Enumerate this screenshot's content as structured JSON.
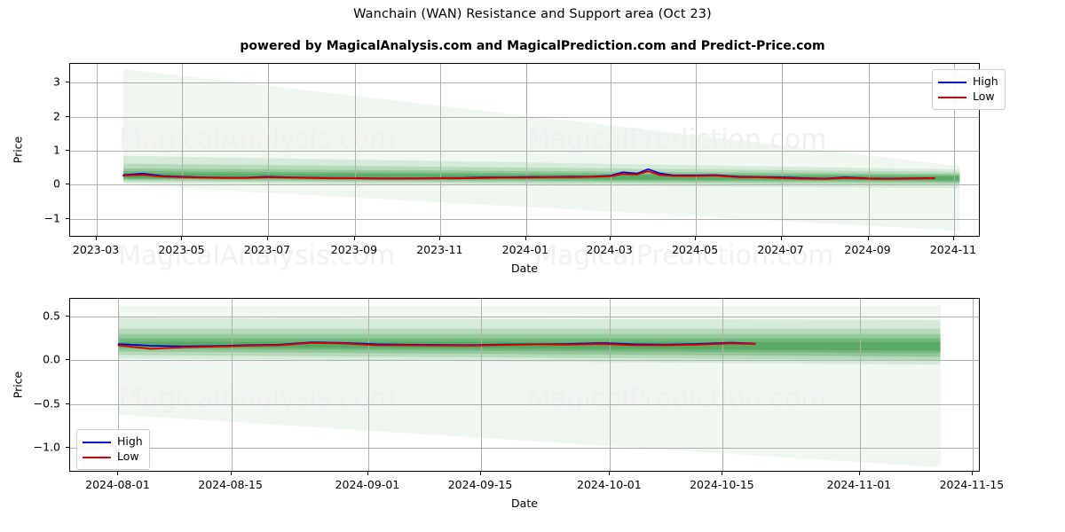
{
  "title": "Wanchain (WAN) Resistance and Support area (Oct 23)",
  "subtitle": "powered by MagicalAnalysis.com and MagicalPrediction.com and Predict-Price.com",
  "watermarks": [
    "MagicalAnalysis.com",
    "MagicalPrediction.com",
    "MagicalAnalysis.com",
    "MagicalPrediction.com",
    "MagicalAnalysis.com",
    "MagicalPrediction.com"
  ],
  "colors": {
    "high": "#0000cd",
    "low": "#dd0000",
    "band": "#3a9b4a",
    "grid": "#b0b0b0",
    "frame": "#000000",
    "watermark": "#f0f0f0"
  },
  "legend": {
    "high_label": "High",
    "low_label": "Low"
  },
  "chart_data": [
    {
      "type": "line",
      "id": "top-chart",
      "title": "Wanchain (WAN) Resistance and Support area (Oct 23)",
      "xlabel": "Date",
      "ylabel": "Price",
      "xlim": [
        "2023-02-10",
        "2024-11-20"
      ],
      "ylim": [
        -1.55,
        3.55
      ],
      "grid": true,
      "legend_position": "upper right",
      "xticks": [
        "2023-03",
        "2023-05",
        "2023-07",
        "2023-09",
        "2023-11",
        "2024-01",
        "2024-03",
        "2024-05",
        "2024-07",
        "2024-09",
        "2024-11"
      ],
      "yticks": [
        -1,
        0,
        1,
        2,
        3
      ],
      "series": [
        {
          "name": "High",
          "color": "#0000cd",
          "x": [
            "2023-03-20",
            "2023-04-03",
            "2023-04-17",
            "2023-05-01",
            "2023-05-15",
            "2023-06-01",
            "2023-06-15",
            "2023-07-01",
            "2023-07-15",
            "2023-08-01",
            "2023-08-15",
            "2023-09-01",
            "2023-09-15",
            "2023-10-01",
            "2023-10-15",
            "2023-11-01",
            "2023-11-15",
            "2023-12-01",
            "2023-12-15",
            "2024-01-01",
            "2024-01-15",
            "2024-02-01",
            "2024-02-15",
            "2024-03-01",
            "2024-03-10",
            "2024-03-20",
            "2024-03-28",
            "2024-04-05",
            "2024-04-15",
            "2024-05-01",
            "2024-05-15",
            "2024-06-01",
            "2024-06-15",
            "2024-07-01",
            "2024-07-15",
            "2024-08-01",
            "2024-08-15",
            "2024-09-01",
            "2024-09-15",
            "2024-10-01",
            "2024-10-18"
          ],
          "values": [
            0.29,
            0.33,
            0.26,
            0.24,
            0.22,
            0.21,
            0.21,
            0.24,
            0.22,
            0.21,
            0.2,
            0.2,
            0.19,
            0.19,
            0.19,
            0.2,
            0.2,
            0.22,
            0.22,
            0.23,
            0.23,
            0.24,
            0.24,
            0.27,
            0.37,
            0.33,
            0.46,
            0.34,
            0.28,
            0.28,
            0.29,
            0.24,
            0.23,
            0.22,
            0.2,
            0.18,
            0.22,
            0.19,
            0.18,
            0.19,
            0.2
          ]
        },
        {
          "name": "Low",
          "color": "#dd0000",
          "x": [
            "2023-03-20",
            "2023-04-03",
            "2023-04-17",
            "2023-05-01",
            "2023-05-15",
            "2023-06-01",
            "2023-06-15",
            "2023-07-01",
            "2023-07-15",
            "2023-08-01",
            "2023-08-15",
            "2023-09-01",
            "2023-09-15",
            "2023-10-01",
            "2023-10-15",
            "2023-11-01",
            "2023-11-15",
            "2023-12-01",
            "2023-12-15",
            "2024-01-01",
            "2024-01-15",
            "2024-02-01",
            "2024-02-15",
            "2024-03-01",
            "2024-03-10",
            "2024-03-20",
            "2024-03-28",
            "2024-04-05",
            "2024-04-15",
            "2024-05-01",
            "2024-05-15",
            "2024-06-01",
            "2024-06-15",
            "2024-07-01",
            "2024-07-15",
            "2024-08-01",
            "2024-08-15",
            "2024-09-01",
            "2024-09-15",
            "2024-10-01",
            "2024-10-18"
          ],
          "values": [
            0.27,
            0.29,
            0.24,
            0.22,
            0.21,
            0.2,
            0.2,
            0.22,
            0.21,
            0.2,
            0.19,
            0.19,
            0.18,
            0.18,
            0.18,
            0.19,
            0.19,
            0.2,
            0.21,
            0.21,
            0.22,
            0.22,
            0.23,
            0.25,
            0.32,
            0.3,
            0.4,
            0.29,
            0.26,
            0.26,
            0.27,
            0.22,
            0.22,
            0.2,
            0.18,
            0.17,
            0.2,
            0.18,
            0.17,
            0.18,
            0.19
          ]
        }
      ],
      "bands": {
        "description": "Resistance and support fan: nested translucent green areas widening to the right",
        "color": "#3a9b4a",
        "start": "2023-03-20",
        "end": "2024-11-05",
        "levels": [
          {
            "opacity": 0.08,
            "left_upper": 3.4,
            "left_lower": 0.0,
            "right_upper": 0.55,
            "right_lower": -1.35
          },
          {
            "opacity": 0.14,
            "left_upper": 0.85,
            "left_lower": 0.05,
            "right_upper": 0.45,
            "right_lower": -0.1
          },
          {
            "opacity": 0.2,
            "left_upper": 0.62,
            "left_lower": 0.1,
            "right_upper": 0.38,
            "right_lower": 0.0
          },
          {
            "opacity": 0.28,
            "left_upper": 0.48,
            "left_lower": 0.14,
            "right_upper": 0.32,
            "right_lower": 0.06
          },
          {
            "opacity": 0.36,
            "left_upper": 0.4,
            "left_lower": 0.17,
            "right_upper": 0.28,
            "right_lower": 0.1
          },
          {
            "opacity": 0.45,
            "left_upper": 0.34,
            "left_lower": 0.2,
            "right_upper": 0.25,
            "right_lower": 0.13
          }
        ]
      }
    },
    {
      "type": "line",
      "id": "bottom-chart",
      "xlabel": "Date",
      "ylabel": "Price",
      "xlim": [
        "2024-07-26",
        "2024-11-16"
      ],
      "ylim": [
        -1.28,
        0.7
      ],
      "grid": true,
      "legend_position": "lower left",
      "xticks": [
        "2024-08-01",
        "2024-08-15",
        "2024-09-01",
        "2024-09-15",
        "2024-10-01",
        "2024-10-15",
        "2024-11-01",
        "2024-11-15"
      ],
      "yticks": [
        -1.0,
        -0.5,
        0.0,
        0.5
      ],
      "series": [
        {
          "name": "High",
          "color": "#0000cd",
          "x": [
            "2024-08-01",
            "2024-08-05",
            "2024-08-09",
            "2024-08-13",
            "2024-08-17",
            "2024-08-21",
            "2024-08-25",
            "2024-08-29",
            "2024-09-02",
            "2024-09-06",
            "2024-09-10",
            "2024-09-14",
            "2024-09-18",
            "2024-09-22",
            "2024-09-26",
            "2024-09-30",
            "2024-10-04",
            "2024-10-08",
            "2024-10-12",
            "2024-10-16",
            "2024-10-19"
          ],
          "values": [
            0.185,
            0.165,
            0.158,
            0.162,
            0.172,
            0.178,
            0.205,
            0.198,
            0.182,
            0.178,
            0.175,
            0.172,
            0.18,
            0.184,
            0.186,
            0.196,
            0.182,
            0.178,
            0.186,
            0.2,
            0.19
          ]
        },
        {
          "name": "Low",
          "color": "#dd0000",
          "x": [
            "2024-08-01",
            "2024-08-05",
            "2024-08-09",
            "2024-08-13",
            "2024-08-17",
            "2024-08-21",
            "2024-08-25",
            "2024-08-29",
            "2024-09-02",
            "2024-09-06",
            "2024-09-10",
            "2024-09-14",
            "2024-09-18",
            "2024-09-22",
            "2024-09-26",
            "2024-09-30",
            "2024-10-04",
            "2024-10-08",
            "2024-10-12",
            "2024-10-16",
            "2024-10-19"
          ],
          "values": [
            0.17,
            0.13,
            0.148,
            0.155,
            0.165,
            0.172,
            0.198,
            0.19,
            0.172,
            0.17,
            0.168,
            0.166,
            0.174,
            0.18,
            0.178,
            0.186,
            0.172,
            0.17,
            0.178,
            0.192,
            0.186
          ]
        }
      ],
      "bands": {
        "description": "Resistance and support fan: nested translucent green areas widening to the right",
        "color": "#3a9b4a",
        "start": "2024-08-01",
        "end": "2024-11-11",
        "levels": [
          {
            "opacity": 0.08,
            "left_upper": 0.62,
            "left_lower": -0.62,
            "right_upper": 0.62,
            "right_lower": -1.22
          },
          {
            "opacity": 0.14,
            "left_upper": 0.48,
            "left_lower": 0.02,
            "right_upper": 0.46,
            "right_lower": -0.05
          },
          {
            "opacity": 0.2,
            "left_upper": 0.36,
            "left_lower": 0.06,
            "right_upper": 0.36,
            "right_lower": 0.0
          },
          {
            "opacity": 0.28,
            "left_upper": 0.3,
            "left_lower": 0.1,
            "right_upper": 0.3,
            "right_lower": 0.04
          },
          {
            "opacity": 0.36,
            "left_upper": 0.25,
            "left_lower": 0.13,
            "right_upper": 0.25,
            "right_lower": 0.08
          },
          {
            "opacity": 0.46,
            "left_upper": 0.21,
            "left_lower": 0.15,
            "right_upper": 0.21,
            "right_lower": 0.11
          }
        ]
      }
    }
  ]
}
